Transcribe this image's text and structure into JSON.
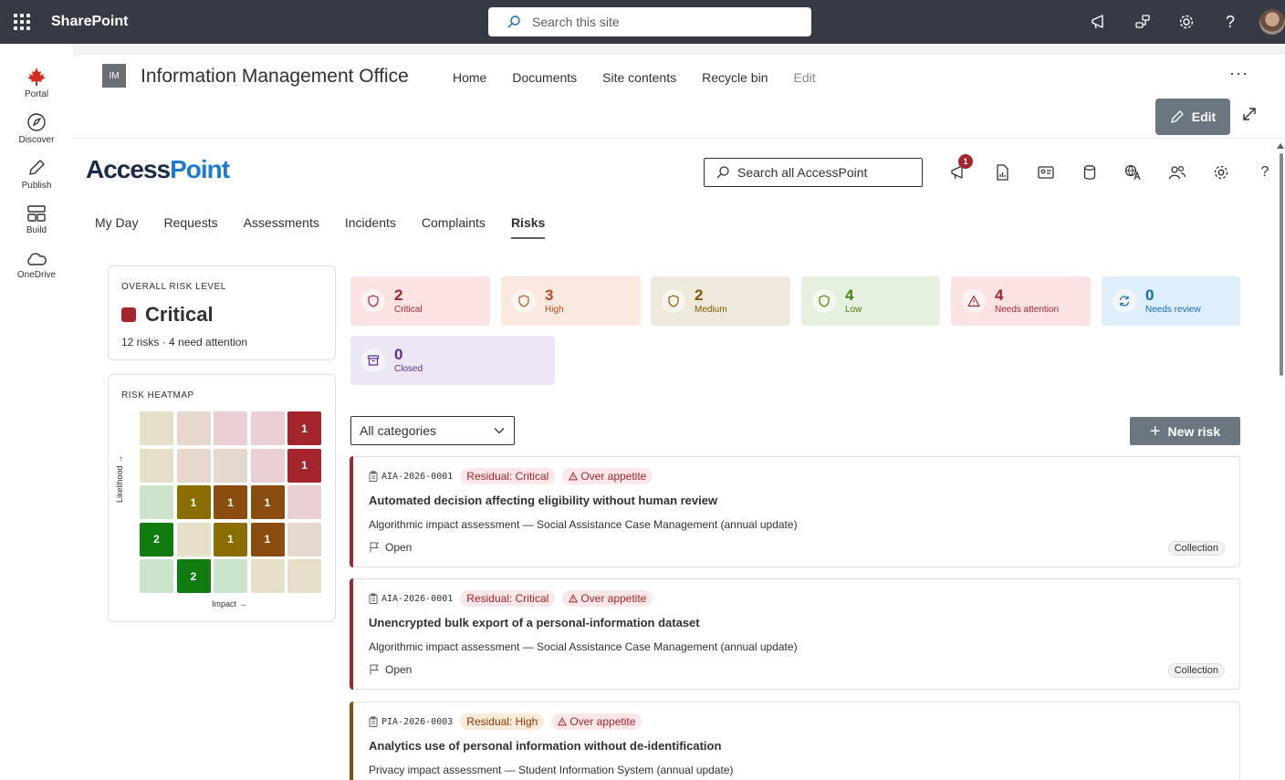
{
  "suite": {
    "title": "SharePoint",
    "search_placeholder": "Search this site"
  },
  "appbar": {
    "items": [
      {
        "label": "Portal",
        "icon": "maple-leaf-icon"
      },
      {
        "label": "Discover",
        "icon": "compass-icon"
      },
      {
        "label": "Publish",
        "icon": "pen-icon"
      },
      {
        "label": "Build",
        "icon": "layout-icon"
      },
      {
        "label": "OneDrive",
        "icon": "cloud-icon"
      }
    ]
  },
  "site": {
    "logo_text": "IM",
    "title": "Information Management Office",
    "nav": [
      "Home",
      "Documents",
      "Site contents",
      "Recycle bin",
      "Edit"
    ],
    "edit_label": "Edit"
  },
  "accesspoint": {
    "logo_a": "Access",
    "logo_b": "Point",
    "search_placeholder": "Search all AccessPoint",
    "notification_count": "1",
    "tabs": [
      "My Day",
      "Requests",
      "Assessments",
      "Incidents",
      "Complaints",
      "Risks"
    ],
    "active_tab": "Risks"
  },
  "overall": {
    "label": "OVERALL RISK LEVEL",
    "level": "Critical",
    "summary": "12 risks · 4 need attention",
    "color": "#a4262c"
  },
  "heatmap": {
    "label": "RISK HEATMAP",
    "ylabel": "Likelihood →",
    "xlabel": "Impact →",
    "rows": [
      [
        {
          "c": "#e5dfc7",
          "v": ""
        },
        {
          "c": "#e6d8cc",
          "v": ""
        },
        {
          "c": "#ebd0d3",
          "v": ""
        },
        {
          "c": "#ebd0d3",
          "v": ""
        },
        {
          "c": "#a4262c",
          "v": "1"
        }
      ],
      [
        {
          "c": "#e5dfc7",
          "v": ""
        },
        {
          "c": "#e6d8cc",
          "v": ""
        },
        {
          "c": "#e6d8cc",
          "v": ""
        },
        {
          "c": "#ebd0d3",
          "v": ""
        },
        {
          "c": "#a4262c",
          "v": "1"
        }
      ],
      [
        {
          "c": "#cce3cc",
          "v": ""
        },
        {
          "c": "#8a6e00",
          "v": "1"
        },
        {
          "c": "#8a4d0f",
          "v": "1"
        },
        {
          "c": "#8a4d0f",
          "v": "1"
        },
        {
          "c": "#ebd0d3",
          "v": ""
        }
      ],
      [
        {
          "c": "#107c10",
          "v": "2"
        },
        {
          "c": "#e5dfc7",
          "v": ""
        },
        {
          "c": "#8a6e00",
          "v": "1"
        },
        {
          "c": "#8a4d0f",
          "v": "1"
        },
        {
          "c": "#e6d8cc",
          "v": ""
        }
      ],
      [
        {
          "c": "#cce3cc",
          "v": ""
        },
        {
          "c": "#107c10",
          "v": "2"
        },
        {
          "c": "#cce3cc",
          "v": ""
        },
        {
          "c": "#e5dfc7",
          "v": ""
        },
        {
          "c": "#e5dfc7",
          "v": ""
        }
      ]
    ]
  },
  "stats": [
    {
      "value": "2",
      "label": "Critical",
      "bg": "#fbe3e4",
      "fg": "#a4262c",
      "icon": "shield-icon"
    },
    {
      "value": "3",
      "label": "High",
      "bg": "#fbe8de",
      "fg": "#b5501e",
      "icon": "shield-icon"
    },
    {
      "value": "2",
      "label": "Medium",
      "bg": "#efe9dc",
      "fg": "#7a5c00",
      "icon": "shield-icon"
    },
    {
      "value": "4",
      "label": "Low",
      "bg": "#e6f0e0",
      "fg": "#498205",
      "icon": "shield-icon"
    },
    {
      "value": "4",
      "label": "Needs attention",
      "bg": "#fbe3e4",
      "fg": "#a4262c",
      "icon": "warning-icon"
    },
    {
      "value": "0",
      "label": "Needs review",
      "bg": "#dfeefb",
      "fg": "#0f6cbd",
      "icon": "refresh-icon"
    },
    {
      "value": "0",
      "label": "Closed",
      "bg": "#ece6f5",
      "fg": "#5c2e91",
      "icon": "archive-icon"
    }
  ],
  "toolbar": {
    "category": "All categories",
    "new_label": "New risk"
  },
  "risks": [
    {
      "id": "AIA-2026-0001",
      "residual": "Residual: Critical",
      "appetite": "Over appetite",
      "title": "Automated decision affecting eligibility without human review",
      "desc": "Algorithmic impact assessment — Social Assistance Case Management (annual update)",
      "status": "Open",
      "tag": "Collection",
      "accent": "#a4262c"
    },
    {
      "id": "AIA-2026-0001",
      "residual": "Residual: Critical",
      "appetite": "Over appetite",
      "title": "Unencrypted bulk export of a personal-information dataset",
      "desc": "Algorithmic impact assessment — Social Assistance Case Management (annual update)",
      "status": "Open",
      "tag": "Collection",
      "accent": "#a4262c"
    },
    {
      "id": "PIA-2026-0003",
      "residual": "Residual: High",
      "appetite": "Over appetite",
      "title": "Analytics use of personal information without de-identification",
      "desc": "Privacy impact assessment — Student Information System (annual update)",
      "status": "",
      "tag": "",
      "accent": "#8a4d0f"
    }
  ]
}
